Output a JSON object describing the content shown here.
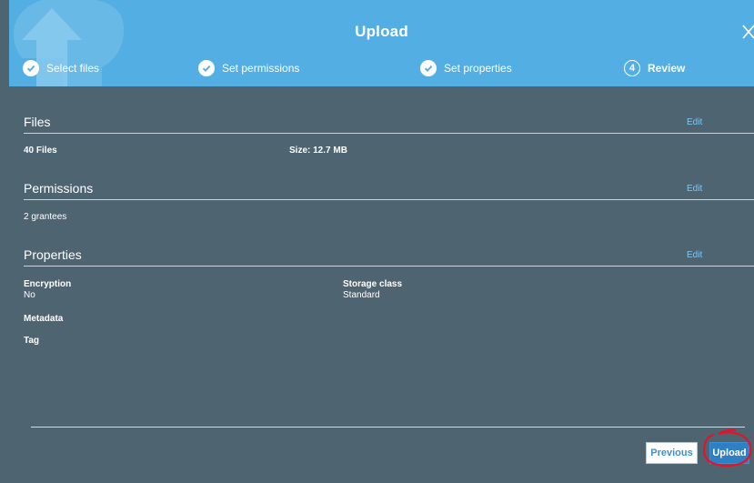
{
  "header": {
    "title": "Upload",
    "steps": [
      {
        "label": "Select files",
        "state": "done"
      },
      {
        "label": "Set permissions",
        "state": "done"
      },
      {
        "label": "Set properties",
        "state": "done"
      },
      {
        "label": "Review",
        "number": "4",
        "state": "current"
      }
    ],
    "close_icon": "close-icon"
  },
  "files": {
    "title": "Files",
    "edit_label": "Edit",
    "count": "40 Files",
    "size": "Size: 12.7 MB"
  },
  "permissions": {
    "title": "Permissions",
    "edit_label": "Edit",
    "grantees": "2 grantees"
  },
  "properties": {
    "title": "Properties",
    "edit_label": "Edit",
    "encryption_label": "Encryption",
    "encryption_value": "No",
    "storage_class_label": "Storage class",
    "storage_class_value": "Standard",
    "metadata_label": "Metadata",
    "tag_label": "Tag"
  },
  "footer": {
    "previous_label": "Previous",
    "upload_label": "Upload"
  },
  "colors": {
    "header_bg": "#53aee3",
    "body_bg": "#4f6471",
    "accent_link": "#7fc8f0",
    "primary_button": "#2f7fc5",
    "annotation_red": "#e3132b"
  }
}
